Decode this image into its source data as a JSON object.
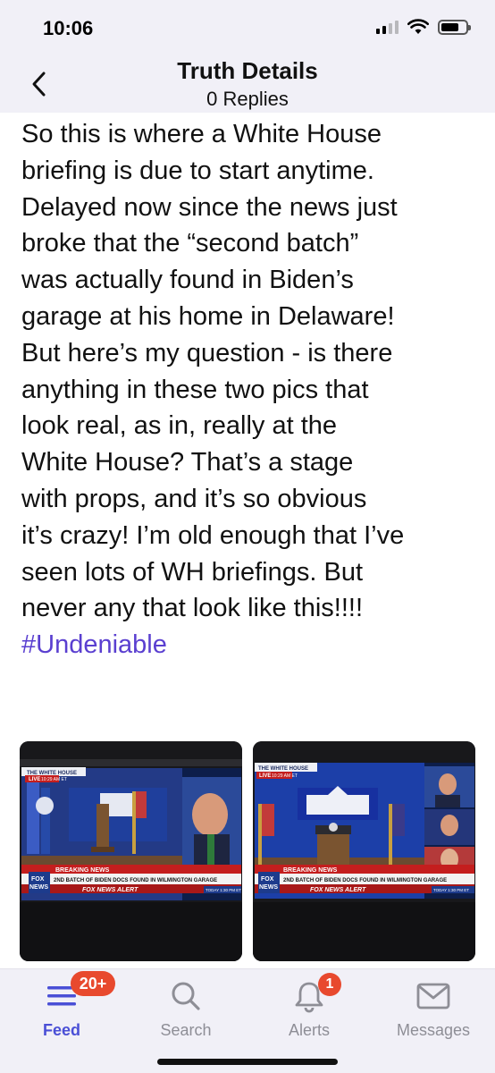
{
  "status_bar": {
    "time": "10:06"
  },
  "header": {
    "title": "Truth Details",
    "subtitle": "0 Replies"
  },
  "post": {
    "text_lines": [
      "So this is where a White House",
      "briefing is due to start anytime.",
      "Delayed now since the news just",
      "broke that the “second batch”",
      "was actually found in Biden’s",
      "garage at his home in Delaware!",
      "But here’s my question - is there",
      "anything in these two pics that",
      "look real, as in, really at the",
      "White House? That’s a stage",
      "with props, and it’s so obvious",
      "it’s crazy! I’m old enough that I’ve",
      "seen lots of WH briefings. But",
      "never any that look like this!!!!"
    ],
    "hashtag": "#Undeniable",
    "hashtag_color": "#5a3fd0"
  },
  "media": [
    {
      "channel_bug": "THE WHITE HOUSE",
      "live": "LIVE",
      "live_time": "10:29 AM ET",
      "breaking": "BREAKING NEWS",
      "headline": "2ND BATCH OF BIDEN DOCS FOUND IN WILMINGTON GARAGE",
      "alert": "FOX NEWS ALERT",
      "logo_top": "FOX",
      "logo_bottom": "NEWS",
      "ticker_time": "TODAY 1:30 PM ET"
    },
    {
      "channel_bug": "THE WHITE HOUSE",
      "live": "LIVE",
      "live_time": "10:29 AM ET",
      "breaking": "BREAKING NEWS",
      "headline": "2ND BATCH OF BIDEN DOCS FOUND IN WILMINGTON GARAGE",
      "alert": "FOX NEWS ALERT",
      "logo_top": "FOX",
      "logo_bottom": "NEWS",
      "ticker_time": "TODAY 1:30 PM ET"
    }
  ],
  "tab_bar": {
    "tabs": [
      {
        "label": "Feed",
        "icon": "feed-icon",
        "badge": "20+",
        "active": true
      },
      {
        "label": "Search",
        "icon": "search-icon",
        "badge": "",
        "active": false
      },
      {
        "label": "Alerts",
        "icon": "bell-icon",
        "badge": "1",
        "active": false
      },
      {
        "label": "Messages",
        "icon": "envelope-icon",
        "badge": "",
        "active": false
      }
    ],
    "active_color": "#4a4fd6",
    "inactive_color": "#8e8e96",
    "badge_color": "#e8492e"
  }
}
